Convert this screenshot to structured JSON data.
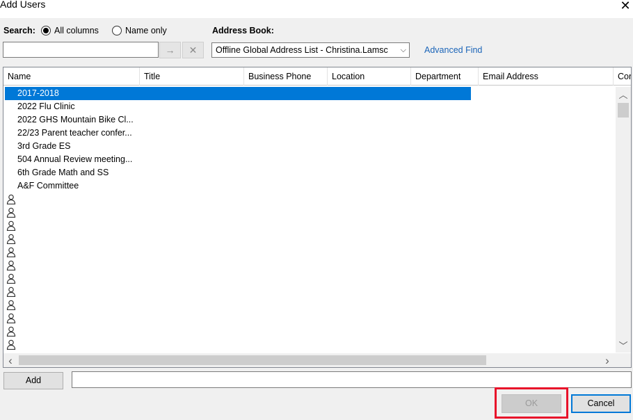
{
  "window": {
    "title": "Add Users",
    "close_glyph": "✕"
  },
  "search": {
    "label": "Search:",
    "options": [
      "All columns",
      "Name only"
    ],
    "selected": "All columns",
    "input_value": "",
    "go_glyph": "→",
    "clear_glyph": "✕"
  },
  "address_book": {
    "label": "Address Book:",
    "selected": "Offline Global Address List - Christina.Lamsc",
    "caret": "⌵",
    "advanced_find": "Advanced Find"
  },
  "grid": {
    "columns": [
      "Name",
      "Title",
      "Business Phone",
      "Location",
      "Department",
      "Email Address",
      "Cor"
    ],
    "rows": [
      {
        "name": "2017-2018",
        "selected": true
      },
      {
        "name": "2022 Flu Clinic"
      },
      {
        "name": "2022 GHS Mountain Bike Cl..."
      },
      {
        "name": "22/23 Parent teacher confer..."
      },
      {
        "name": "3rd Grade ES"
      },
      {
        "name": "504 Annual Review meeting..."
      },
      {
        "name": "6th Grade Math and SS"
      },
      {
        "name": "A&F Committee"
      }
    ],
    "person_icon": "person-icon",
    "person_rows_visible": 12,
    "scroll_up": "︿",
    "scroll_down": "﹀",
    "scroll_left": "‹",
    "scroll_right": "›"
  },
  "footer": {
    "add_label": "Add",
    "add_field_value": "",
    "ok_label": "OK",
    "cancel_label": "Cancel",
    "highlight_color": "#e8122a",
    "accent_color": "#0078d7"
  }
}
